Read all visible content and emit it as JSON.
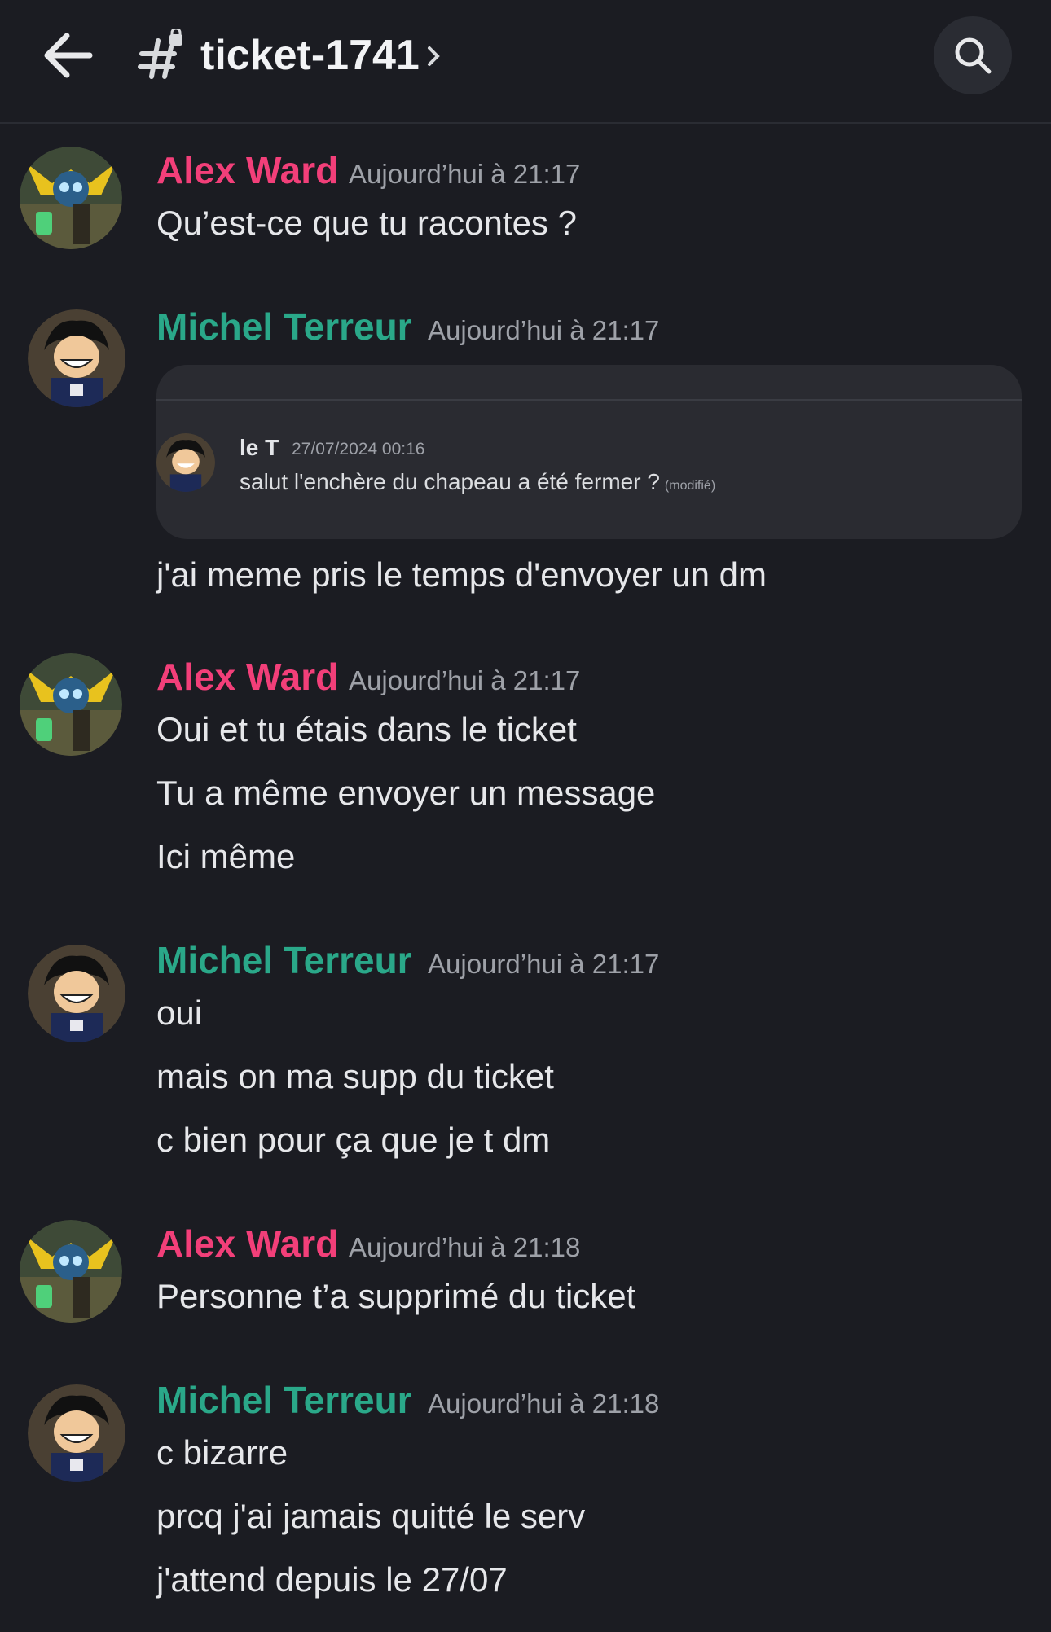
{
  "header": {
    "back_icon": "arrow-left-icon",
    "channel_icon": "hash-lock-icon",
    "channel_name": "ticket-1741",
    "chevron_icon": "chevron-right-icon",
    "search_icon": "search-icon"
  },
  "colors": {
    "background": "#1b1c22",
    "alex_name": "#f23f79",
    "michel_name": "#2aa889",
    "timestamp": "#9ea1a8",
    "message_text": "#e6e7ea"
  },
  "messages": [
    {
      "author": "Alex Ward",
      "time": "Aujourd’hui à 21:17",
      "lines": [
        "Qu’est-ce que tu racontes ?"
      ]
    },
    {
      "author": "Michel Terreur",
      "time": "Aujourd’hui à 21:17",
      "embed": {
        "author": "le T",
        "date": "27/07/2024 00:16",
        "text": "salut l'enchère du chapeau a été fermer ?",
        "edited": "(modifié)"
      },
      "lines": [
        "j'ai meme pris le temps d'envoyer un dm"
      ]
    },
    {
      "author": "Alex Ward",
      "time": "Aujourd’hui à 21:17",
      "lines": [
        "Oui et tu étais dans le ticket",
        "Tu a même envoyer un message",
        "Ici même"
      ]
    },
    {
      "author": "Michel Terreur",
      "time": "Aujourd’hui à 21:17",
      "lines": [
        "oui",
        "mais on ma supp du ticket",
        "c bien pour ça que je t dm"
      ]
    },
    {
      "author": "Alex Ward",
      "time": "Aujourd’hui à 21:18",
      "lines": [
        "Personne t’a supprimé du ticket"
      ]
    },
    {
      "author": "Michel Terreur",
      "time": "Aujourd’hui à 21:18",
      "lines": [
        "c bizarre",
        "prcq j'ai jamais quitté le serv",
        "j'attend depuis le 27/07"
      ]
    }
  ]
}
